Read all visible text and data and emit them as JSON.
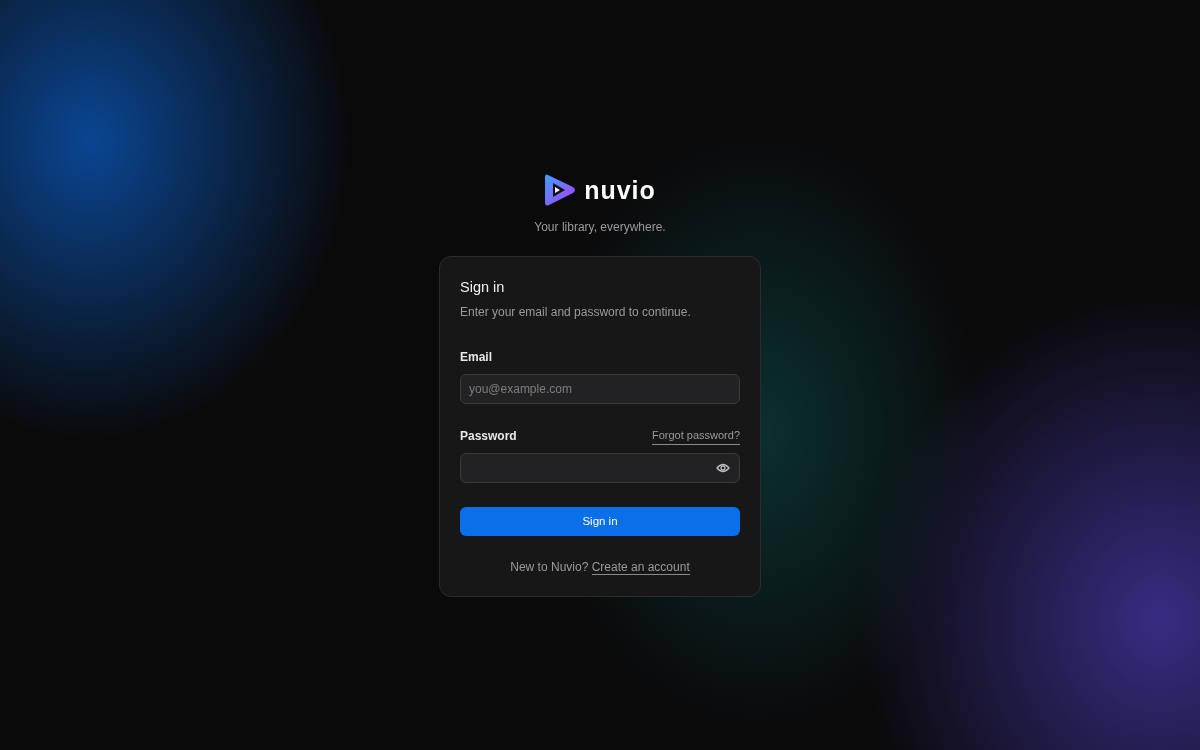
{
  "brand": {
    "name": "nuvio",
    "tagline": "Your library, everywhere."
  },
  "card": {
    "title": "Sign in",
    "subtitle": "Enter your email and password to continue."
  },
  "fields": [
    {
      "kind": "email",
      "label": "Email",
      "placeholder": "you@example.com"
    },
    {
      "kind": "password",
      "label": "Password",
      "link": "Forgot password?"
    }
  ],
  "submit": "Sign in",
  "footer": {
    "text": "New to Nuvio?",
    "link": "Create an account"
  }
}
